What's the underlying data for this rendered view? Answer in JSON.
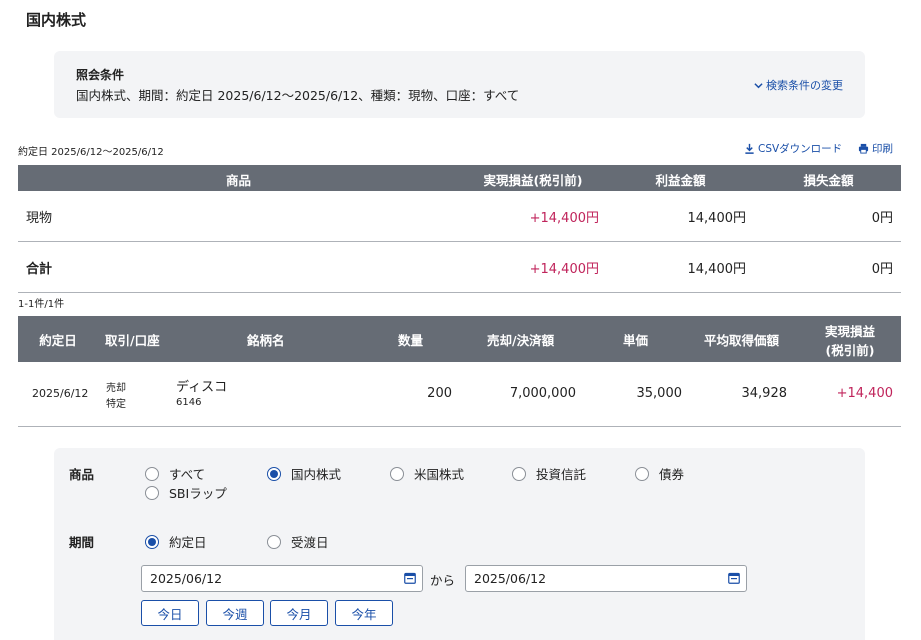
{
  "page": {
    "title": "国内株式"
  },
  "conditions": {
    "label": "照会条件",
    "text": "国内株式、期間：約定日 2025/6/12〜2025/6/12、種類：現物、口座：すべて",
    "change_link": "検索条件の変更"
  },
  "toolbar": {
    "range_label": "約定日 2025/6/12〜2025/6/12",
    "csv_label": "CSVダウンロード",
    "print_label": "印刷"
  },
  "summary_table": {
    "headers": {
      "product": "商品",
      "realized": "実現損益(税引前)",
      "profit": "利益金額",
      "loss": "損失金額"
    },
    "rows": [
      {
        "product": "現物",
        "realized": "+14,400円",
        "profit": "14,400円",
        "loss": "0円"
      }
    ],
    "total": {
      "product": "合計",
      "realized": "+14,400円",
      "profit": "14,400円",
      "loss": "0円"
    }
  },
  "results_count": "1-1件/1件",
  "trade_table": {
    "headers": {
      "date": "約定日",
      "trade_account": "取引/口座",
      "name": "銘柄名",
      "quantity": "数量",
      "amount": "売却/決済額",
      "price": "単価",
      "avg_cost": "平均取得価額",
      "realized_line1": "実現損益",
      "realized_line2": "(税引前)"
    },
    "rows": [
      {
        "date": "2025/6/12",
        "trade": "売却",
        "account": "特定",
        "name": "ディスコ",
        "code": "6146",
        "quantity": "200",
        "amount": "7,000,000",
        "price": "35,000",
        "avg_cost": "34,928",
        "realized": "+14,400"
      }
    ]
  },
  "search_form": {
    "product_label": "商品",
    "product_options": [
      "すべて",
      "国内株式",
      "米国株式",
      "投資信託",
      "債券",
      "SBIラップ"
    ],
    "product_selected": "国内株式",
    "period_label": "期間",
    "period_options": [
      "約定日",
      "受渡日"
    ],
    "period_selected": "約定日",
    "from_date": "2025/06/12",
    "to_date": "2025/06/12",
    "kara": "から",
    "quick_buttons": [
      "今日",
      "今週",
      "今月",
      "今年"
    ]
  },
  "colors": {
    "header_bg": "#666c75",
    "positive": "#c0245b",
    "link": "#1a4fa8",
    "panel_bg": "#f3f4f6"
  }
}
